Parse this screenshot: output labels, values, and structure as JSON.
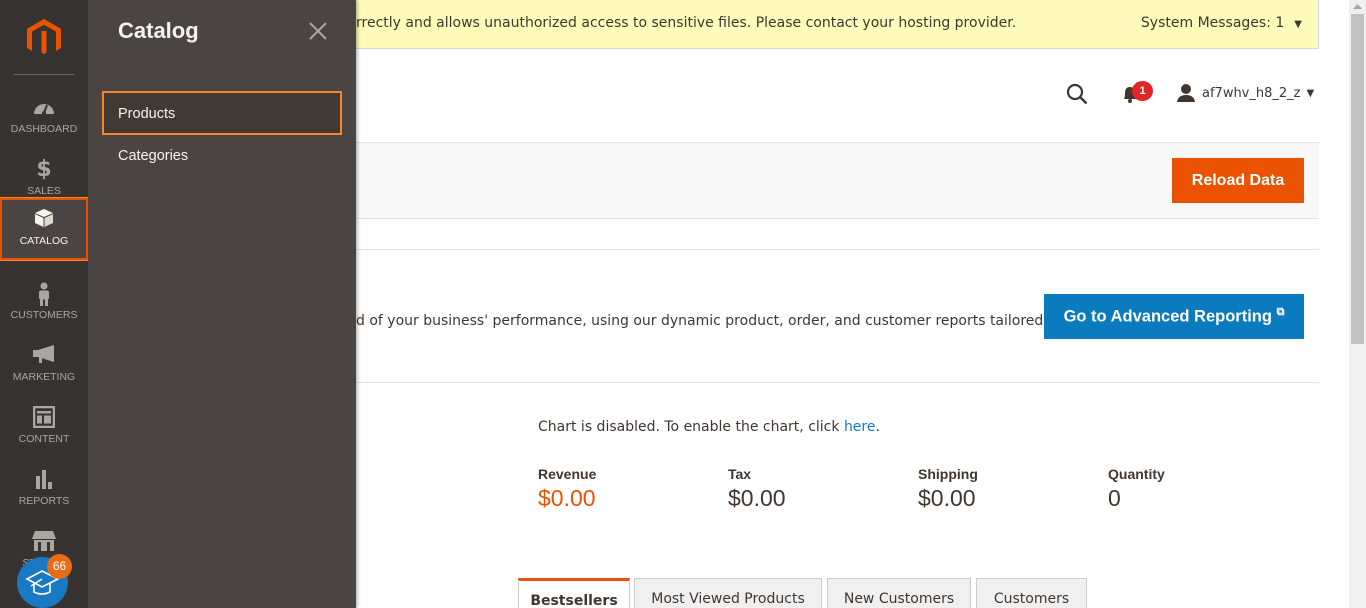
{
  "nav": {
    "items": [
      {
        "label": "DASHBOARD",
        "icon": "dashboard-gauge"
      },
      {
        "label": "SALES",
        "icon": "dollar-sign"
      },
      {
        "label": "CATALOG",
        "icon": "box",
        "active": true
      },
      {
        "label": "CUSTOMERS",
        "icon": "person"
      },
      {
        "label": "MARKETING",
        "icon": "megaphone"
      },
      {
        "label": "CONTENT",
        "icon": "layout"
      },
      {
        "label": "REPORTS",
        "icon": "bar-chart"
      },
      {
        "label": "STORES",
        "icon": "storefront"
      }
    ],
    "learning_badge_count": "66"
  },
  "submenu": {
    "title": "Catalog",
    "items": [
      {
        "label": "Products",
        "active": true
      },
      {
        "label": "Categories"
      }
    ]
  },
  "system_message": {
    "text": "rrectly and allows unauthorized access to sensitive files. Please contact your hosting provider.",
    "count_label": "System Messages: 1"
  },
  "header": {
    "notifications_count": "1",
    "username": "af7whv_h8_2_z"
  },
  "actions": {
    "reload_label": "Reload Data"
  },
  "advanced_reporting": {
    "text": "d of your business' performance, using our dynamic product, order, and customer reports tailored to",
    "button_label": "Go to Advanced Reporting"
  },
  "chart": {
    "disabled_text": "Chart is disabled. To enable the chart, click ",
    "link_label": "here",
    "suffix": "."
  },
  "stats": [
    {
      "label": "Revenue",
      "value": "$0.00"
    },
    {
      "label": "Tax",
      "value": "$0.00"
    },
    {
      "label": "Shipping",
      "value": "$0.00"
    },
    {
      "label": "Quantity",
      "value": "0"
    }
  ],
  "tabs": [
    {
      "label": "Bestsellers",
      "active": true
    },
    {
      "label": "Most Viewed Products"
    },
    {
      "label": "New Customers"
    },
    {
      "label": "Customers"
    }
  ],
  "colors": {
    "accent": "#eb5202",
    "nav_bg": "#373330",
    "submenu_bg": "#4a4542",
    "link": "#1979c3",
    "message_bg": "#fffbbb"
  }
}
